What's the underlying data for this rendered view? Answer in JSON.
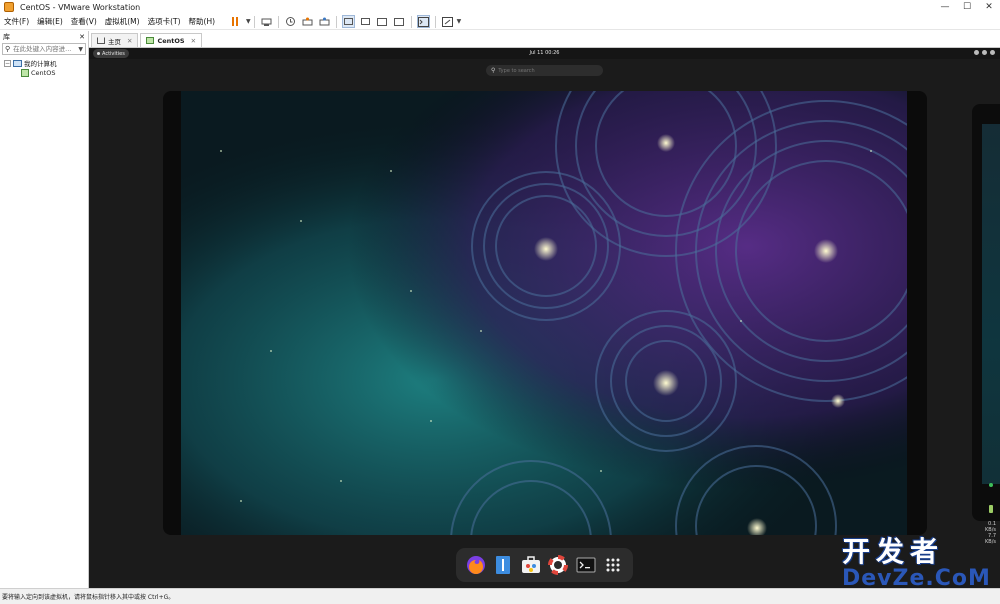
{
  "window": {
    "title": "CentOS - VMware Workstation",
    "controls": [
      "—",
      "☐",
      "✕"
    ]
  },
  "menu": {
    "items": [
      "文件(F)",
      "编辑(E)",
      "查看(V)",
      "虚拟机(M)",
      "选项卡(T)",
      "帮助(H)"
    ]
  },
  "toolbar": {
    "icons": [
      "pause-icon",
      "send-ctrl-alt-del-icon",
      "snapshot-icon",
      "revert-snapshot-icon",
      "manage-snapshots-icon",
      "show-library-icon",
      "thumbnail-bar-icon",
      "fit-guest-icon",
      "fullscreen-icon",
      "console-view-icon",
      "stretch-guest-icon"
    ]
  },
  "library": {
    "title": "库",
    "close": "✕",
    "search_placeholder": "在此处键入内容进...",
    "tree": {
      "root": "我的计算机",
      "children": [
        "CentOS"
      ]
    }
  },
  "tabs": [
    {
      "label": "主页",
      "icon": "home-icon",
      "active": false
    },
    {
      "label": "CentOS",
      "icon": "vm-icon",
      "active": true
    }
  ],
  "guest": {
    "activities": "Activities",
    "clock": "Jul 11  00:26",
    "search_placeholder": "Type to search",
    "side_info": [
      "0.1",
      "KB/s",
      "7.7",
      "KB/s"
    ],
    "dock": [
      "firefox-icon",
      "text-editor-icon",
      "software-icon",
      "help-icon",
      "terminal-icon",
      "app-grid-icon"
    ]
  },
  "status": {
    "message": "要将输入定向到该虚拟机，请将鼠标指针移入其中或按 Ctrl+G。"
  },
  "watermark": {
    "cn": "开发者",
    "en": "DevZe.CoM"
  },
  "colors": {
    "pause": "#e87400",
    "gnome_bg": "#1b1b1b",
    "wall_teal": "#1f8a8a",
    "wall_purple": "#5a2d8a"
  }
}
